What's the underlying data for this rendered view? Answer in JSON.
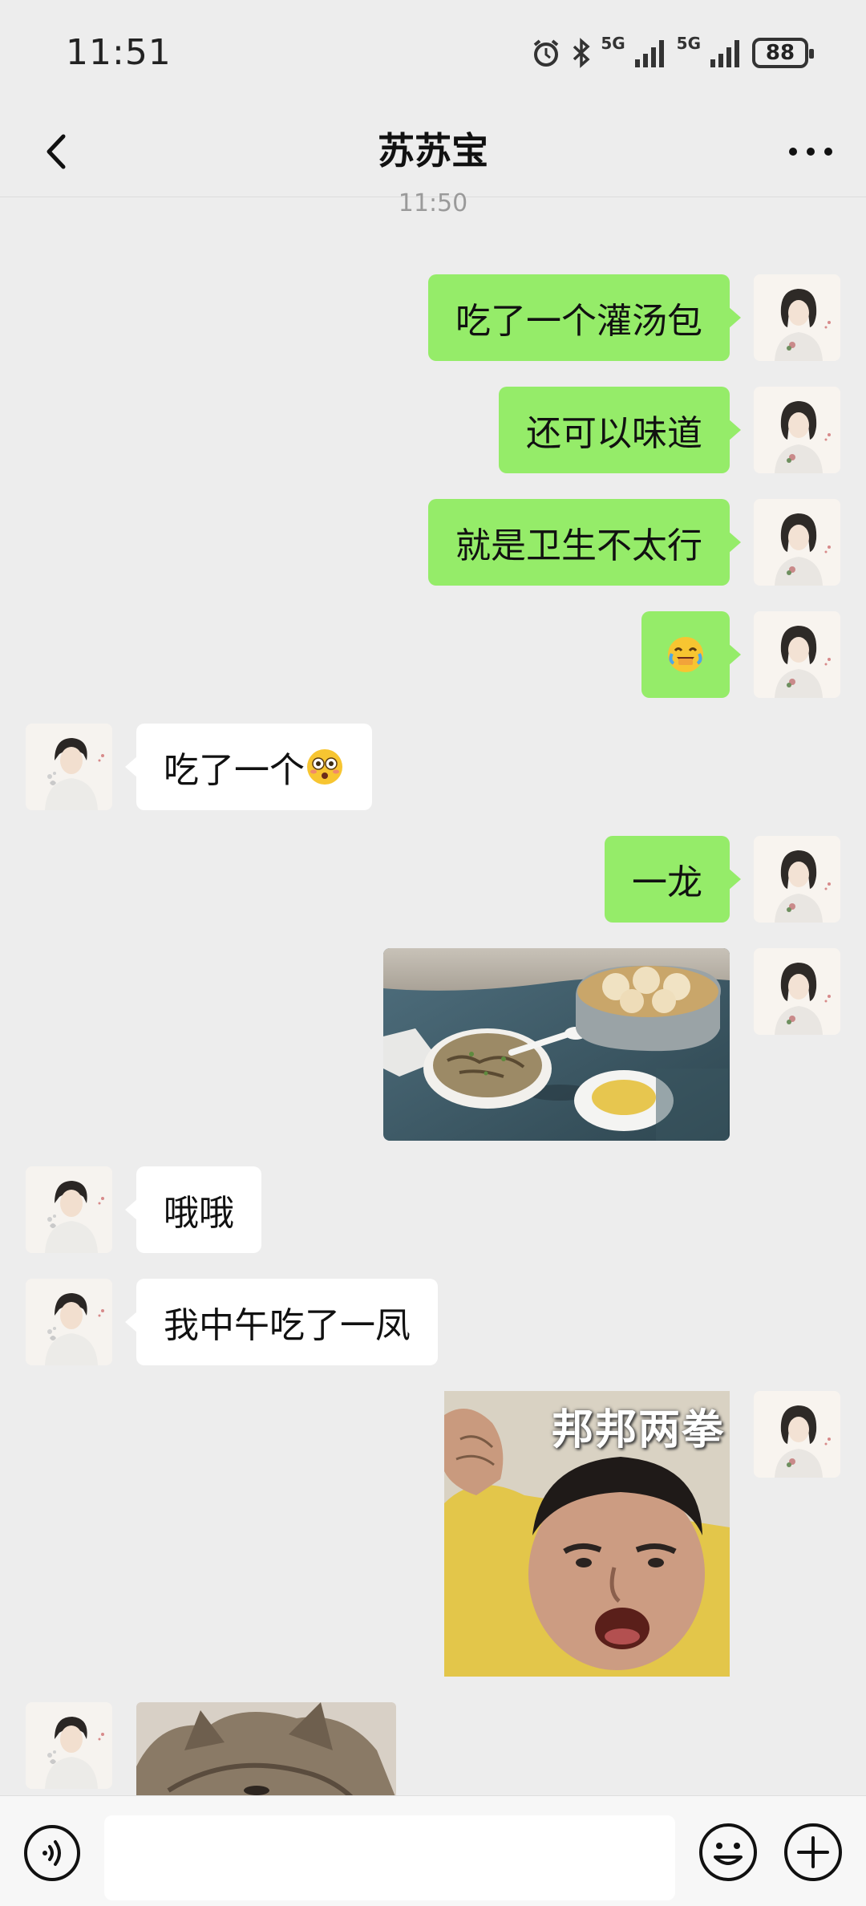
{
  "status": {
    "time": "11:51",
    "network1": "5G",
    "network2": "5G",
    "battery": "88"
  },
  "nav": {
    "title": "苏苏宝"
  },
  "timestamp": "11:50",
  "messages": [
    {
      "from": "me",
      "text": "吃了一个灌汤包"
    },
    {
      "from": "me",
      "text": "还可以味道"
    },
    {
      "from": "me",
      "text": "就是卫生不太行"
    },
    {
      "from": "me",
      "emoji": "laughing-crying"
    },
    {
      "from": "them",
      "text": "吃了一个",
      "emoji": "flushed"
    },
    {
      "from": "me",
      "text": "一龙"
    },
    {
      "from": "me",
      "image": "food photo: soup bowl and steamer of soup dumplings"
    },
    {
      "from": "them",
      "text": "哦哦"
    },
    {
      "from": "them",
      "text": "我中午吃了一凤"
    },
    {
      "from": "me",
      "sticker_text": "邦邦两拳"
    },
    {
      "from": "them",
      "image": "cat photo"
    }
  ],
  "colors": {
    "background": "#ededed",
    "my_bubble": "#95ec69",
    "their_bubble": "#ffffff",
    "sticker_bg": "#e3c64a"
  },
  "icons": {
    "back": "chevron-left-icon",
    "more": "more-dots-icon",
    "voice": "voice-icon",
    "emoji": "emoji-icon",
    "plus": "plus-icon"
  }
}
